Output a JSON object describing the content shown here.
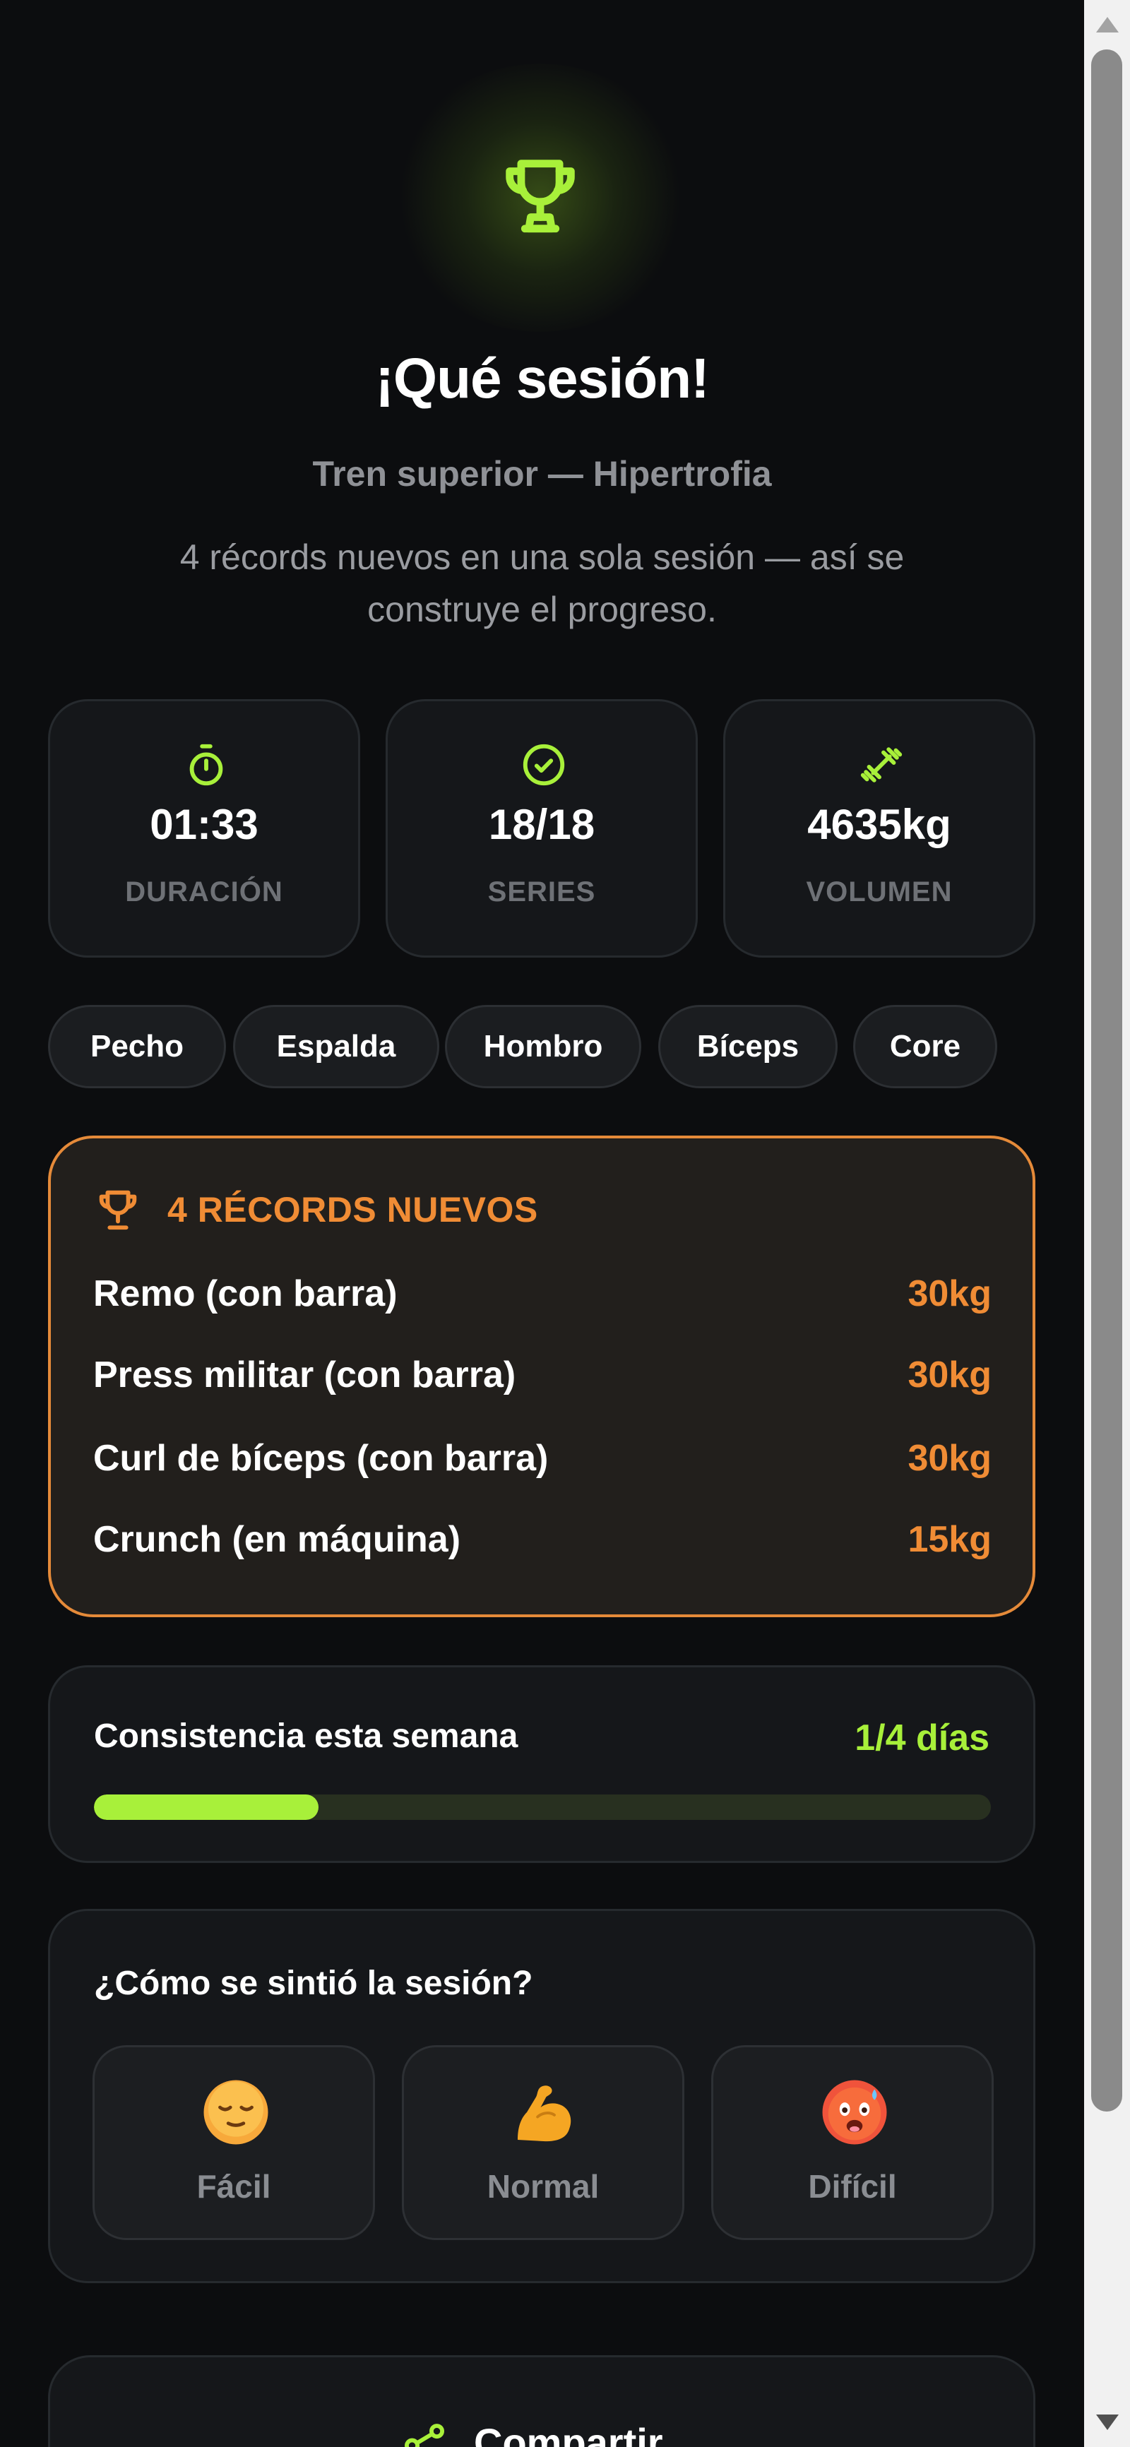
{
  "hero": {
    "title": "¡Qué sesión!",
    "subtitle": "Tren superior — Hipertrofia",
    "message": "4 récords nuevos en una sola sesión — así se construye el progreso.",
    "icon": "trophy-icon"
  },
  "stats": [
    {
      "icon": "timer-icon",
      "value": "01:33",
      "label": "DURACIÓN"
    },
    {
      "icon": "check-circle-icon",
      "value": "18/18",
      "label": "SERIES"
    },
    {
      "icon": "dumbbell-icon",
      "value": "4635kg",
      "label": "VOLUMEN"
    }
  ],
  "muscles": [
    "Pecho",
    "Espalda",
    "Hombro",
    "Bíceps",
    "Core"
  ],
  "records": {
    "title": "4 RÉCORDS NUEVOS",
    "items": [
      {
        "name": "Remo (con barra)",
        "value": "30kg"
      },
      {
        "name": "Press militar (con barra)",
        "value": "30kg"
      },
      {
        "name": "Curl de bíceps (con barra)",
        "value": "30kg"
      },
      {
        "name": "Crunch (en máquina)",
        "value": "15kg"
      }
    ]
  },
  "consistency": {
    "label": "Consistencia esta semana",
    "value": "1/4 días",
    "progress_fraction": 0.25
  },
  "feeling": {
    "question": "¿Cómo se sintió la sesión?",
    "options": [
      {
        "emoji": "relieved-face",
        "label": "Fácil"
      },
      {
        "emoji": "flexed-biceps",
        "label": "Normal"
      },
      {
        "emoji": "hot-face",
        "label": "Difícil"
      }
    ]
  },
  "share": {
    "label": "Compartir",
    "icon": "share-icon"
  },
  "colors": {
    "accent_green": "#a8f03a",
    "accent_orange": "#f08c35",
    "background": "#0c0d0f",
    "card": "#15171a"
  }
}
